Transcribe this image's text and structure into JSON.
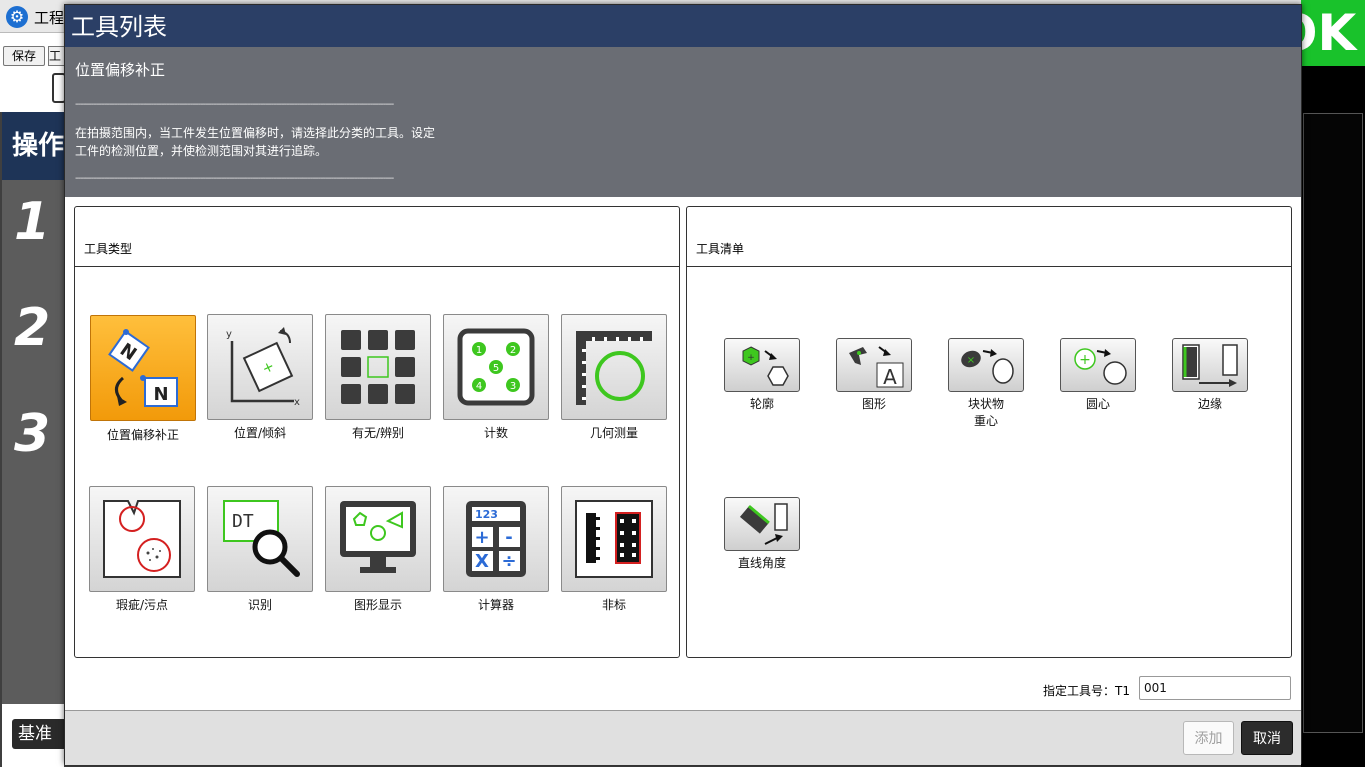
{
  "background": {
    "app_title": "工程",
    "save_label": "保存",
    "tool_label": "工",
    "ops_heading": "操作",
    "steps": [
      "1",
      "2",
      "3"
    ],
    "base_label": "基准",
    "judgement": "OK",
    "judgement_color": "#19c22b"
  },
  "dialog": {
    "title": "工具列表",
    "description": {
      "heading": "位置偏移补正",
      "separator": "--------------------------------------------------------------------------------------------------------------------------",
      "line1": "在拍摄范围内，当工件发生位置偏移时，请选择此分类的工具。设定",
      "line2": "工件的检测位置，并使检测范围对其进行追踪。"
    },
    "tool_type": {
      "header": "工具类型",
      "items": [
        {
          "label": "位置偏移补正",
          "selected": true,
          "icon": "position-offset-icon"
        },
        {
          "label": "位置/倾斜",
          "selected": false,
          "icon": "position-tilt-icon"
        },
        {
          "label": "有无/辨别",
          "selected": false,
          "icon": "presence-grid-icon"
        },
        {
          "label": "计数",
          "selected": false,
          "icon": "count-icon"
        },
        {
          "label": "几何测量",
          "selected": false,
          "icon": "geometry-measure-icon"
        },
        {
          "label": "瑕疵/污点",
          "selected": false,
          "icon": "defect-stain-icon"
        },
        {
          "label": "识别",
          "selected": false,
          "icon": "recognition-magnifier-icon"
        },
        {
          "label": "图形显示",
          "selected": false,
          "icon": "graphic-display-icon"
        },
        {
          "label": "计算器",
          "selected": false,
          "icon": "calculator-icon"
        },
        {
          "label": "非标",
          "selected": false,
          "icon": "nonstandard-icon"
        }
      ]
    },
    "tool_list": {
      "header": "工具清单",
      "items": [
        {
          "label": "轮廓",
          "icon": "contour-icon"
        },
        {
          "label": "图形",
          "icon": "pattern-icon"
        },
        {
          "label": "块状物\n重心",
          "icon": "blob-centroid-icon"
        },
        {
          "label": "圆心",
          "icon": "circle-center-icon"
        },
        {
          "label": "边缘",
          "icon": "edge-icon"
        },
        {
          "label": "直线角度",
          "icon": "line-angle-icon"
        }
      ]
    },
    "tool_number": {
      "label": "指定工具号：T1",
      "value": "001"
    },
    "buttons": {
      "add": "添加",
      "cancel": "取消"
    },
    "colors": {
      "title_bar": "#2b3f66",
      "description_bg": "#6a6d74",
      "selected_tile": "#f29a0a",
      "icon_green": "#3ec71f"
    }
  }
}
